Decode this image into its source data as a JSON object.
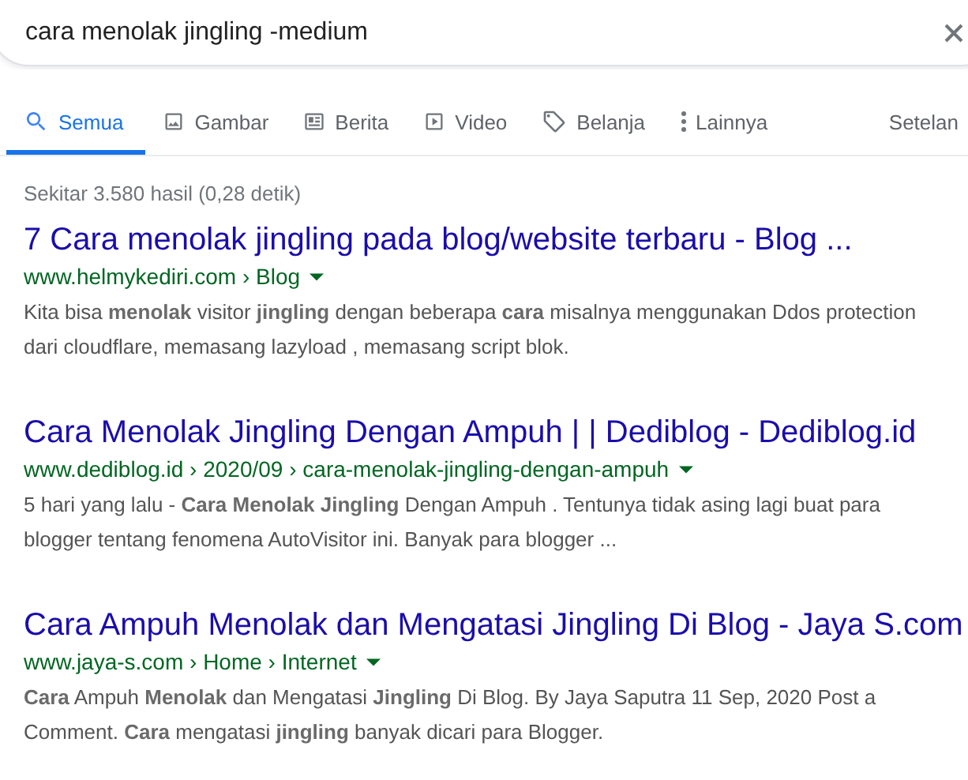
{
  "search": {
    "value": "cara menolak jingling -medium"
  },
  "tabs": [
    {
      "label": "Semua",
      "kind": "search",
      "selected": true
    },
    {
      "label": "Gambar",
      "kind": "image",
      "selected": false
    },
    {
      "label": "Berita",
      "kind": "news",
      "selected": false
    },
    {
      "label": "Video",
      "kind": "video",
      "selected": false
    },
    {
      "label": "Belanja",
      "kind": "tag",
      "selected": false
    },
    {
      "label": "Lainnya",
      "kind": "more",
      "selected": false
    }
  ],
  "settings_link": "Setelan",
  "result_stats": "Sekitar 3.580 hasil (0,28 detik)",
  "results": [
    {
      "title": "7 Cara menolak jingling pada blog/website terbaru - Blog ...",
      "url": "www.helmykediri.com › Blog",
      "snippet": "Kita bisa **menolak** visitor **jingling** dengan beberapa **cara** misalnya menggunakan Ddos protection dari cloudflare, memasang lazyload , memasang script blok."
    },
    {
      "title": "Cara Menolak Jingling Dengan Ampuh | | Dediblog - Dediblog.id",
      "url": "www.dediblog.id › 2020/09 › cara-menolak-jingling-dengan-ampuh",
      "snippet": "5 hari yang lalu - **Cara Menolak Jingling** Dengan Ampuh . Tentunya tidak asing lagi buat para blogger tentang fenomena AutoVisitor ini. Banyak para blogger ..."
    },
    {
      "title": "Cara Ampuh Menolak dan Mengatasi Jingling Di Blog - Jaya S.com",
      "url": "www.jaya-s.com › Home › Internet",
      "snippet": "**Cara** Ampuh **Menolak** dan Mengatasi **Jingling** Di Blog. By Jaya Saputra 11 Sep, 2020 Post a Comment. **Cara** mengatasi **jingling** banyak dicari para Blogger."
    }
  ]
}
